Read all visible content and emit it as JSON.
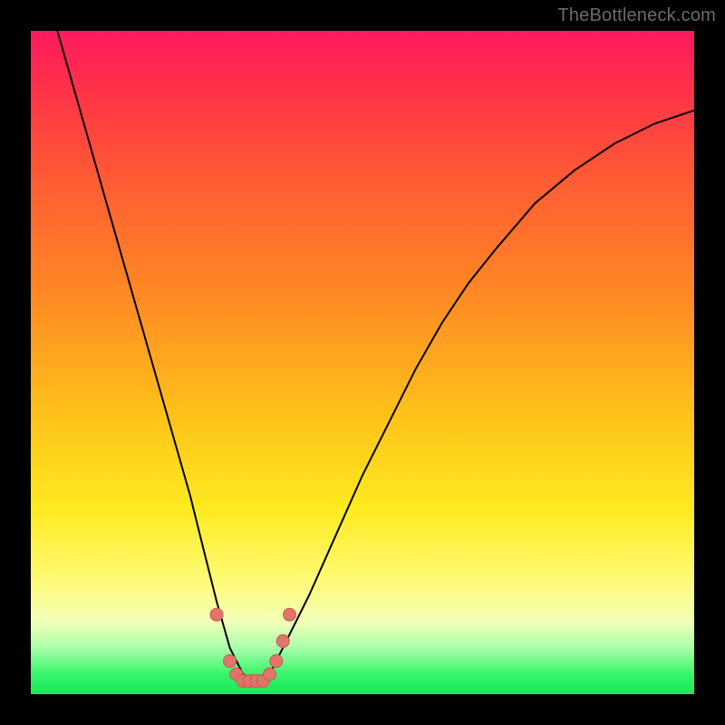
{
  "watermark": "TheBottleneck.com",
  "colors": {
    "background": "#000000",
    "curve": "#000000",
    "marker_fill": "#e2756a",
    "marker_stroke": "#c85a4f",
    "gradient_stops": [
      "#ff1a5e",
      "#ff2f4a",
      "#ff5a34",
      "#ff8a24",
      "#ffc21a",
      "#ffea20",
      "#fffb78",
      "#f2ffb8",
      "#aaffaa",
      "#35f56a",
      "#17e85c"
    ]
  },
  "chart_data": {
    "type": "line",
    "title": "",
    "xlabel": "",
    "ylabel": "",
    "xlim": [
      0,
      100
    ],
    "ylim": [
      0,
      100
    ],
    "series": [
      {
        "name": "bottleneck-curve",
        "x": [
          4,
          8,
          12,
          16,
          20,
          24,
          26,
          28,
          30,
          32,
          34,
          36,
          38,
          42,
          46,
          50,
          54,
          58,
          62,
          66,
          70,
          76,
          82,
          88,
          94,
          100
        ],
        "values": [
          100,
          86,
          72,
          58,
          44,
          30,
          22,
          14,
          7,
          3,
          2,
          3,
          7,
          15,
          24,
          33,
          41,
          49,
          56,
          62,
          67,
          74,
          79,
          83,
          86,
          88
        ]
      }
    ],
    "markers": {
      "name": "highlight-points",
      "x": [
        28,
        30,
        31,
        32,
        33,
        34,
        35,
        36,
        37,
        38,
        39
      ],
      "values": [
        12,
        5,
        3,
        2,
        2,
        2,
        2,
        3,
        5,
        8,
        12
      ]
    }
  }
}
